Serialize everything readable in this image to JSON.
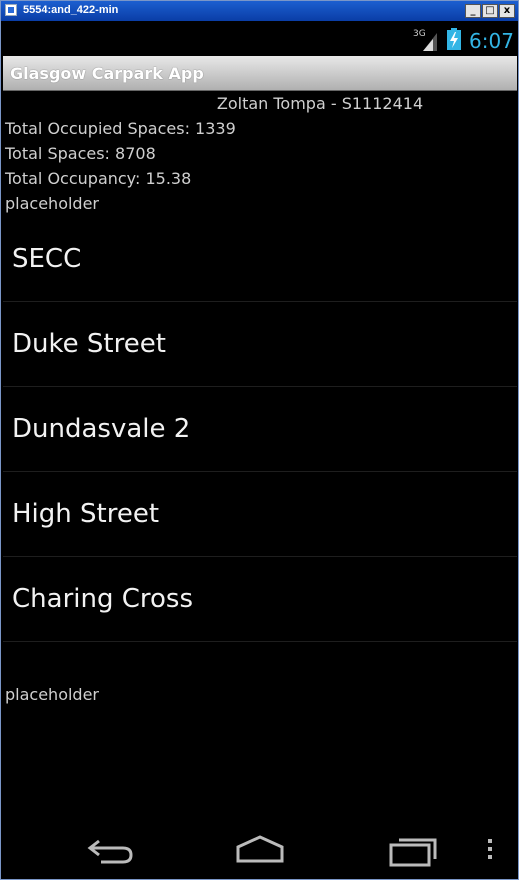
{
  "window": {
    "title": "5554:and_422-min",
    "min_label": "_",
    "max_label": "□",
    "close_label": "x"
  },
  "status_bar": {
    "network": "3G",
    "time": "6:07"
  },
  "action_bar": {
    "title": "Glasgow Carpark App"
  },
  "header": {
    "author": "Zoltan Tompa - S1112414",
    "occupied": "Total Occupied Spaces: 1339",
    "total": "Total Spaces: 8708",
    "occupancy": "Total Occupancy: 15.38",
    "placeholder_top": "placeholder"
  },
  "carparks": [
    "SECC",
    "Duke Street",
    "Dundasvale 2",
    "High Street",
    "Charing Cross"
  ],
  "placeholder_bottom": "placeholder",
  "nav": {
    "back": "back-icon",
    "home": "home-icon",
    "recents": "recents-icon",
    "menu": "overflow-menu-icon"
  }
}
